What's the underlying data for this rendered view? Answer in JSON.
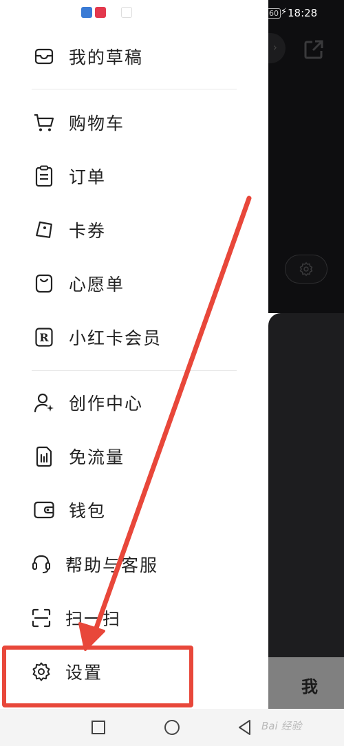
{
  "status": {
    "time": "18:28",
    "battery": "60"
  },
  "menu": {
    "items": [
      {
        "label": "我的草稿",
        "icon": "inbox-icon"
      },
      {
        "label": "购物车",
        "icon": "cart-icon"
      },
      {
        "label": "订单",
        "icon": "clipboard-icon"
      },
      {
        "label": "卡券",
        "icon": "ticket-icon"
      },
      {
        "label": "心愿单",
        "icon": "bag-icon"
      },
      {
        "label": "小红卡会员",
        "icon": "r-badge-icon"
      },
      {
        "label": "创作中心",
        "icon": "user-plus-icon"
      },
      {
        "label": "免流量",
        "icon": "sim-icon"
      },
      {
        "label": "钱包",
        "icon": "wallet-icon"
      },
      {
        "label": "帮助与客服",
        "icon": "headset-icon"
      },
      {
        "label": "扫一扫",
        "icon": "scan-icon"
      },
      {
        "label": "设置",
        "icon": "gear-icon"
      }
    ]
  },
  "background": {
    "tab_me": "我",
    "r_badge": "R"
  },
  "watermark": "Bai 经验",
  "colors": {
    "annotation": "#e8473a",
    "text": "#222222",
    "backdrop": "#0e0e10"
  }
}
